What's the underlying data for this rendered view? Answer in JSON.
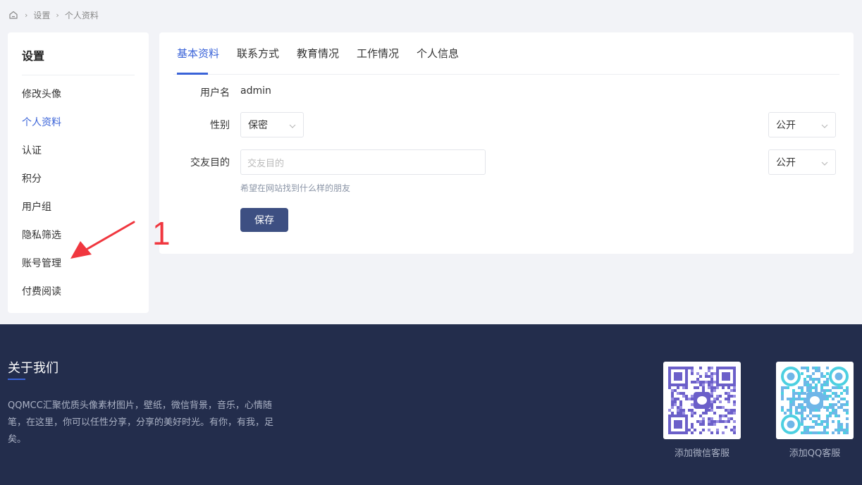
{
  "breadcrumb": {
    "home_icon": "home-icon",
    "items": [
      "设置",
      "个人资料"
    ],
    "sep": "›"
  },
  "sidebar": {
    "title": "设置",
    "items": [
      {
        "label": "修改头像"
      },
      {
        "label": "个人资料",
        "active": true
      },
      {
        "label": "认证"
      },
      {
        "label": "积分"
      },
      {
        "label": "用户组"
      },
      {
        "label": "隐私筛选"
      },
      {
        "label": "账号管理"
      },
      {
        "label": "付费阅读"
      }
    ]
  },
  "tabs": [
    "基本资料",
    "联系方式",
    "教育情况",
    "工作情况",
    "个人信息"
  ],
  "form": {
    "username_label": "用户名",
    "username_value": "admin",
    "gender_label": "性别",
    "gender_value": "保密",
    "gender_privacy": "公开",
    "purpose_label": "交友目的",
    "purpose_placeholder": "交友目的",
    "purpose_privacy": "公开",
    "purpose_hint": "希望在网站找到什么样的朋友",
    "save_label": "保存"
  },
  "annotation": {
    "number": "1",
    "color": "#f0373f"
  },
  "footer": {
    "title": "关于我们",
    "description": "QQMCC汇聚优质头像素材图片，壁纸，微信背景，音乐，心情随笔，在这里，你可以任性分享，分享的美好时光。有你，有我，足矣。",
    "wechat_caption": "添加微信客服",
    "qq_caption": "添加QQ客服"
  },
  "colors": {
    "accent": "#3a63d8",
    "button": "#3d4f82",
    "footer_bg": "#232d4c"
  }
}
